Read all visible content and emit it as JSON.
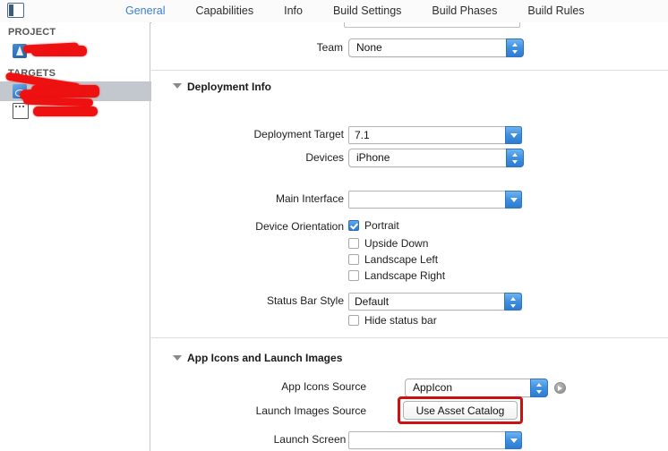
{
  "window": {
    "sidebar_toggle_icon": "sidebar-toggle-icon"
  },
  "tabs": [
    {
      "label": "General",
      "active": true
    },
    {
      "label": "Capabilities",
      "active": false
    },
    {
      "label": "Info",
      "active": false
    },
    {
      "label": "Build Settings",
      "active": false
    },
    {
      "label": "Build Phases",
      "active": false
    },
    {
      "label": "Build Rules",
      "active": false
    }
  ],
  "sidebar": {
    "groups": [
      {
        "header": "PROJECT",
        "items": [
          {
            "icon": "project-icon",
            "label": "",
            "redacted": true,
            "selected": false
          }
        ]
      },
      {
        "header": "TARGETS",
        "items": [
          {
            "icon": "target-app-icon",
            "label": "",
            "redacted": true,
            "selected": true
          },
          {
            "icon": "target-tests-icon",
            "label": "",
            "redacted": true,
            "selected": false
          }
        ]
      }
    ]
  },
  "form": {
    "identity": {
      "team": {
        "label": "Team",
        "value": "None",
        "control": "popup"
      }
    },
    "deployment_info": {
      "title": "Deployment Info",
      "deployment_target": {
        "label": "Deployment Target",
        "value": "7.1",
        "control": "combo"
      },
      "devices": {
        "label": "Devices",
        "value": "iPhone",
        "control": "popup"
      },
      "main_interface": {
        "label": "Main Interface",
        "value": "",
        "control": "combo"
      },
      "device_orientation": {
        "label": "Device Orientation",
        "options": [
          {
            "label": "Portrait",
            "checked": true
          },
          {
            "label": "Upside Down",
            "checked": false
          },
          {
            "label": "Landscape Left",
            "checked": false
          },
          {
            "label": "Landscape Right",
            "checked": false
          }
        ]
      },
      "status_bar_style": {
        "label": "Status Bar Style",
        "value": "Default",
        "control": "popup"
      },
      "hide_status_bar": {
        "label": "Hide status bar",
        "checked": false
      }
    },
    "app_icons_and_launch_images": {
      "title": "App Icons and Launch Images",
      "app_icons_source": {
        "label": "App Icons Source",
        "value": "AppIcon",
        "control": "popup",
        "goto_icon": "goto-arrow-icon"
      },
      "launch_images_source": {
        "label": "Launch Images Source",
        "button_label": "Use Asset Catalog",
        "highlighted": true
      },
      "launch_screen_file": {
        "label": "Launch Screen File",
        "value": "",
        "control": "combo"
      }
    }
  },
  "annotation": {
    "highlight_color": "#cc1111",
    "redaction_color": "#ee1111"
  }
}
